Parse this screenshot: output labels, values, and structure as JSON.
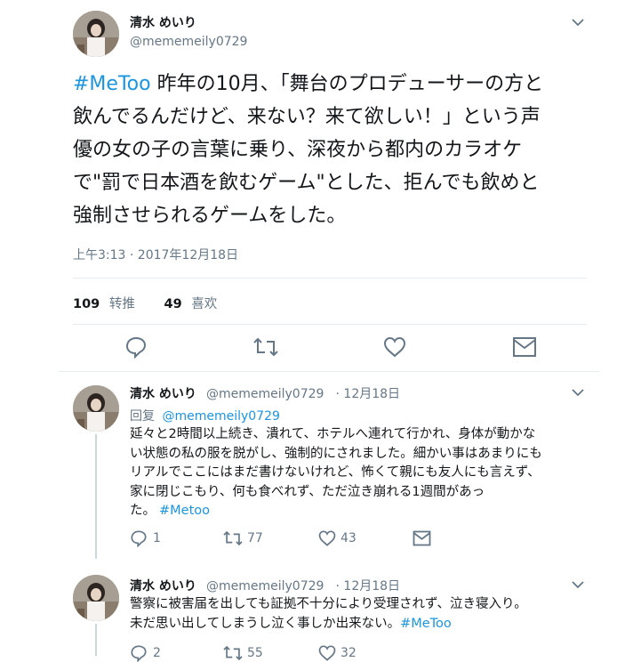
{
  "main_tweet": {
    "name": "清水 めいり",
    "handle": "@mememeily0729",
    "hashtag": "#MeToo",
    "text_lines": [
      " 昨年の10月、「舞台のプロデューサーの方と",
      "飲んでるんだけど、来ない？来て欲しい！」という声",
      "優の女の子の言葉に乗り、深夜から都内のカラオケ",
      "で\"罰で日本酒を飲むゲーム\"とした、拒んでも飲めと",
      "強制させられるゲームをした。"
    ],
    "timestamp": "上午3:13 · 2017年12月18日",
    "retweets_count": "109",
    "retweets_label": "转推",
    "likes_count": "49",
    "likes_label": "喜欢"
  },
  "replies": [
    {
      "name": "清水 めいり",
      "handle": "@mememeily0729",
      "date": "· 12月18日",
      "reply_to_label": "回复",
      "reply_to_handle": "@mememeily0729",
      "text_lines": [
        "延々と2時間以上続き、潰れて、ホテルへ連れて行かれ、身体が動かな",
        "い状態の私の服を脱がし、強制的にされました。細かい事はあまりにも",
        "リアルでここにはまだ書けないけれど、怖くて親にも友人にも言えず、",
        "家に閉じこもり、何も食べれず、ただ泣き崩れる1週間があっ",
        "た。"
      ],
      "hashtag": "#Metoo",
      "reply_count": "1",
      "retweet_count": "77",
      "like_count": "43"
    },
    {
      "name": "清水 めいり",
      "handle": "@mememeily0729",
      "date": "· 12月18日",
      "text_lines": [
        "警察に被害届を出しても証拠不十分により受理されず、泣き寝入り。",
        "未だ思い出してしまうし泣く事しか出来ない。"
      ],
      "hashtag": "#MeToo",
      "reply_count": "2",
      "retweet_count": "55",
      "like_count": "32"
    }
  ],
  "colors": {
    "link": "#1b95e0",
    "muted": "#657786",
    "divider": "#e6ecf0"
  }
}
